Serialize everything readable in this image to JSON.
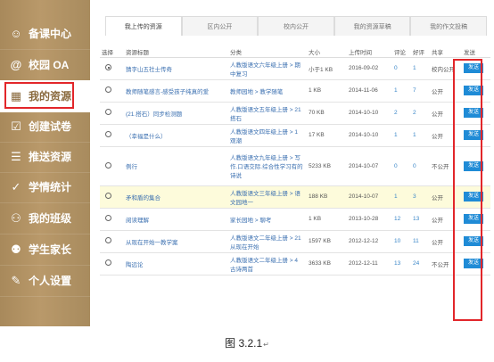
{
  "sidebar": {
    "items": [
      {
        "icon": "☺",
        "label": "备课中心",
        "active": false
      },
      {
        "icon": "@",
        "label": "校园 OA",
        "active": false
      },
      {
        "icon": "▦",
        "label": "我的资源",
        "active": true
      },
      {
        "icon": "☑",
        "label": "创建试卷",
        "active": false
      },
      {
        "icon": "☰",
        "label": "推送资源",
        "active": false
      },
      {
        "icon": "✓",
        "label": "学情统计",
        "active": false
      },
      {
        "icon": "⚇",
        "label": "我的班级",
        "active": false
      },
      {
        "icon": "⚉",
        "label": "学生家长",
        "active": false
      },
      {
        "icon": "✎",
        "label": "个人设置",
        "active": false
      }
    ]
  },
  "tabs": [
    "我上传的资源",
    "区内公开",
    "校内公开",
    "我的资源草稿",
    "我的作文投稿"
  ],
  "table": {
    "headers": [
      "选择",
      "资源标题",
      "分类",
      "大小",
      "上传时间",
      "评论",
      "好评",
      "共享",
      "发送"
    ],
    "send_label": "发送",
    "rows": [
      {
        "title": "猜字山五社士传奇",
        "category": "人教版语文六年级上册 > 期中复习",
        "size": "小于1 KB",
        "date": "2016-09-02",
        "comments": "0",
        "likes": "1",
        "share": "校内公开",
        "selected": true
      },
      {
        "title": "教师随笔感言-感受孩子纯真的爱",
        "category": "教师园地 > 教学随笔",
        "size": "1 KB",
        "date": "2014-11-06",
        "comments": "1",
        "likes": "7",
        "share": "公开"
      },
      {
        "title": "(21.搭石）同步检测题",
        "category": "人教版语文五年级上册 > 21 搭石",
        "size": "70 KB",
        "date": "2014-10-10",
        "comments": "2",
        "likes": "2",
        "share": "公开"
      },
      {
        "title": "（幸福是什么）",
        "category": "人教版语文四年级上册 > 1 观潮",
        "size": "17 KB",
        "date": "2014-10-10",
        "comments": "1",
        "likes": "1",
        "share": "公开"
      },
      {
        "title": "例行",
        "category": "人教版语文九年级上册 > 写作.口语交际.综合性学习有的诗说",
        "size": "5233 KB",
        "date": "2014-10-07",
        "comments": "0",
        "likes": "0",
        "share": "不公开",
        "tall": true
      },
      {
        "title": "矛和盾的集合",
        "category": "人教版语文三年级上册 > 语文园地一",
        "size": "188 KB",
        "date": "2014-10-07",
        "comments": "1",
        "likes": "3",
        "share": "公开",
        "highlight": true
      },
      {
        "title": "阅读理解",
        "category": "家长园地 > 聊考",
        "size": "1 KB",
        "date": "2013-10-28",
        "comments": "12",
        "likes": "13",
        "share": "公开"
      },
      {
        "title": "从现在开始一教学案",
        "category": "人教版语文二年级上册 > 21 从现在开始",
        "size": "1597 KB",
        "date": "2012-12-12",
        "comments": "10",
        "likes": "11",
        "share": "公开"
      },
      {
        "title": "陶远论",
        "category": "人教版语文二年级上册 > 4 古诗两首",
        "size": "3633 KB",
        "date": "2012-12-11",
        "comments": "13",
        "likes": "24",
        "share": "不公开"
      }
    ]
  },
  "caption": {
    "text": "图 3.2.1",
    "mark": "↵"
  }
}
